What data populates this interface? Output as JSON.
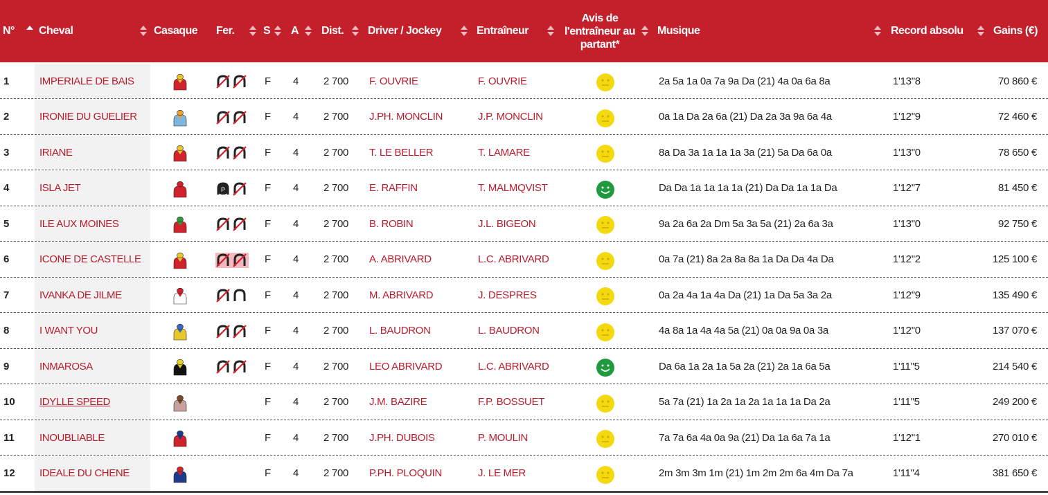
{
  "colors": {
    "header_bg": "#c4202c",
    "accent_red": "#b71c2c",
    "face_yellow": "#f5d90f",
    "face_green": "#1f9a3f"
  },
  "headers": {
    "num": "N°",
    "horse": "Cheval",
    "silk": "Casaque",
    "shoeing": "Fer.",
    "sex": "S",
    "age": "A",
    "dist": "Dist.",
    "driver": "Driver / Jockey",
    "trainer": "Entraîneur",
    "opinion": "Avis de l'entraîneur au partant*",
    "music": "Musique",
    "record": "Record absolu",
    "earnings": "Gains (€)"
  },
  "rows": [
    {
      "num": "1",
      "horse": "IMPERIALE DE BAIS",
      "silk": [
        "#e8c82a",
        "#d0222a"
      ],
      "shoe": "shoe-d4-icon",
      "sex": "F",
      "age": "4",
      "dist": "2 700",
      "driver": "F. OUVRIE",
      "trainer": "F. OUVRIE",
      "opinion": "neutral-face-icon",
      "music": "2a 5a 1a 0a 7a 9a Da (21) 4a 0a 6a 8a",
      "record": "1'13\"8",
      "earnings": "70 860 €"
    },
    {
      "num": "2",
      "horse": "IRONIE DU GUELIER",
      "silk": [
        "#e8a23a",
        "#7fb6e0"
      ],
      "shoe": "shoe-d4-icon",
      "sex": "F",
      "age": "4",
      "dist": "2 700",
      "driver": "J.PH. MONCLIN",
      "trainer": "J.P. MONCLIN",
      "opinion": "neutral-face-icon",
      "music": "0a 1a Da 2a 6a (21) Da 2a 3a 9a 6a 4a",
      "record": "1'12\"9",
      "earnings": "72 460 €"
    },
    {
      "num": "3",
      "horse": "IRIANE",
      "silk": [
        "#e8c82a",
        "#d0222a"
      ],
      "shoe": "shoe-d4-icon",
      "sex": "F",
      "age": "4",
      "dist": "2 700",
      "driver": "T. LE BELLER",
      "trainer": "T. LAMARE",
      "opinion": "neutral-face-icon",
      "music": "8a Da 3a 1a 1a 1a 3a (21) 5a Da 6a 0a",
      "record": "1'13\"0",
      "earnings": "78 650 €"
    },
    {
      "num": "4",
      "horse": "ISLA JET",
      "silk": [
        "#d0222a",
        "#d0222a"
      ],
      "shoe": "shoe-plate-da-icon",
      "sex": "F",
      "age": "4",
      "dist": "2 700",
      "driver": "E. RAFFIN",
      "trainer": "T. MALMQVIST",
      "opinion": "happy-face-icon",
      "music": "Da Da 1a 1a 1a 1a (21) Da Da 1a 1a Da",
      "record": "1'12\"7",
      "earnings": "81 450 €"
    },
    {
      "num": "5",
      "horse": "ILE AUX MOINES",
      "silk": [
        "#2a9a3a",
        "#d0222a"
      ],
      "shoe": "shoe-d4-icon",
      "sex": "F",
      "age": "4",
      "dist": "2 700",
      "driver": "B. ROBIN",
      "trainer": "J.L. BIGEON",
      "opinion": "neutral-face-icon",
      "music": "9a 2a 6a 2a Dm 5a 3a 5a (21) 2a 6a 3a",
      "record": "1'13\"0",
      "earnings": "92 750 €"
    },
    {
      "num": "6",
      "horse": "ICONE DE CASTELLE",
      "silk": [
        "#e8c82a",
        "#d0222a"
      ],
      "shoe": "shoe-d4-highlight-icon",
      "sex": "F",
      "age": "4",
      "dist": "2 700",
      "driver": "A. ABRIVARD",
      "trainer": "L.C. ABRIVARD",
      "opinion": "neutral-face-icon",
      "music": "0a 7a (21) 8a 2a 8a 8a 1a Da Da 4a Da",
      "record": "1'12\"2",
      "earnings": "125 100 €"
    },
    {
      "num": "7",
      "horse": "IVANKA DE JILME",
      "silk": [
        "#d0222a",
        "#ffffff"
      ],
      "shoe": "shoe-da-icon",
      "sex": "F",
      "age": "4",
      "dist": "2 700",
      "driver": "M. ABRIVARD",
      "trainer": "J. DESPRES",
      "opinion": "neutral-face-icon",
      "music": "0a 2a 4a 1a 4a Da (21) 1a Da 5a 3a 2a",
      "record": "1'12\"9",
      "earnings": "135 490 €"
    },
    {
      "num": "8",
      "horse": "I WANT YOU",
      "silk": [
        "#3a6ab8",
        "#e8c82a"
      ],
      "shoe": "shoe-d4-icon",
      "sex": "F",
      "age": "4",
      "dist": "2 700",
      "driver": "L. BAUDRON",
      "trainer": "L. BAUDRON",
      "opinion": "neutral-face-icon",
      "music": "4a 8a 1a 4a 4a 5a (21) 0a 0a 9a 0a 3a",
      "record": "1'12\"0",
      "earnings": "137 070 €"
    },
    {
      "num": "9",
      "horse": "INMAROSA",
      "silk": [
        "#e8d020",
        "#111111"
      ],
      "shoe": "shoe-d4-icon",
      "sex": "F",
      "age": "4",
      "dist": "2 700",
      "driver": "LEO ABRIVARD",
      "trainer": "L.C. ABRIVARD",
      "opinion": "happy-face-icon",
      "music": "Da 6a 1a 2a 1a 5a 2a (21) 2a 1a 6a 5a",
      "record": "1'11\"5",
      "earnings": "214 540 €"
    },
    {
      "num": "10",
      "horse": "IDYLLE SPEED",
      "silk": [
        "#7a4a2a",
        "#c8a0a0"
      ],
      "shoe": "",
      "sex": "F",
      "age": "4",
      "dist": "2 700",
      "driver": "J.M. BAZIRE",
      "trainer": "F.P. BOSSUET",
      "opinion": "neutral-face-icon",
      "music": "5a 7a (21) 1a 2a 1a 2a 1a 1a 1a Da 2a",
      "record": "1'11\"5",
      "earnings": "249 200 €"
    },
    {
      "num": "11",
      "horse": "INOUBLIABLE",
      "silk": [
        "#1e3a8a",
        "#d0222a"
      ],
      "shoe": "",
      "sex": "F",
      "age": "4",
      "dist": "2 700",
      "driver": "J.PH. DUBOIS",
      "trainer": "P. MOULIN",
      "opinion": "neutral-face-icon",
      "music": "7a 7a 6a 4a 0a 9a (21) Da 1a 6a 7a 1a",
      "record": "1'12\"1",
      "earnings": "270 010 €"
    },
    {
      "num": "12",
      "horse": "IDEALE DU CHENE",
      "silk": [
        "#d0222a",
        "#1e3a8a"
      ],
      "shoe": "",
      "sex": "F",
      "age": "4",
      "dist": "2 700",
      "driver": "P.PH. PLOQUIN",
      "trainer": "J. LE MER",
      "opinion": "neutral-face-icon",
      "music": "2m 3m 3m 1m (21) 1m 2m 2m 6a 4m Da 7a",
      "record": "1'11\"4",
      "earnings": "381 650 €"
    }
  ]
}
